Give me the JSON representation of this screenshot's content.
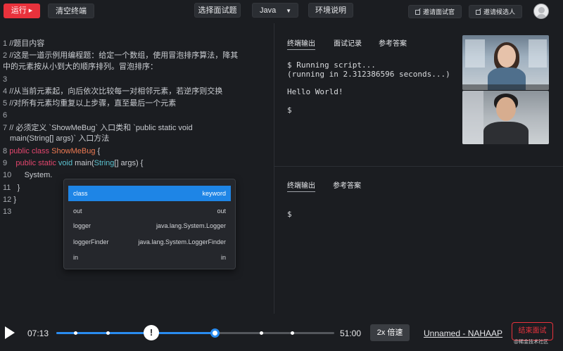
{
  "toolbar": {
    "run_label": "运行",
    "clear_label": "清空终端",
    "choose_question_label": "选择面试题",
    "language_value": "Java",
    "env_label": "环境说明",
    "invite_interviewer_label": "邀请面试官",
    "invite_candidate_label": "邀请候选人"
  },
  "editor": {
    "lines": [
      {
        "num": "1",
        "text": "//题目内容"
      },
      {
        "num": "2",
        "text": "//这是一道示例用编程题：给定一个数组，使用冒泡排序算法，降其"
      },
      {
        "num": "",
        "text": "中的元素按从小到大的顺序排列。冒泡排序："
      },
      {
        "num": "3",
        "text": ""
      },
      {
        "num": "4",
        "text": "//从当前元素起，向后依次比较每一对相邻元素，若逆序则交换"
      },
      {
        "num": "5",
        "text": "//对所有元素均重复以上步骤，直至最后一个元素"
      },
      {
        "num": "6",
        "text": ""
      },
      {
        "num": "7",
        "text": "// 必须定义 `ShowMeBug` 入口类和 `public static void"
      },
      {
        "num": "",
        "text": "main(String[] args)` 入口方法"
      },
      {
        "num": "8",
        "kw1": "public class ",
        "cls": "ShowMeBug",
        "rest": " {"
      },
      {
        "num": "9",
        "kw1": "public static ",
        "typ1": "void",
        "mid": " main(",
        "typ2": "String",
        "rest": "[] args) {"
      },
      {
        "num": "10",
        "text": "System."
      },
      {
        "num": "11",
        "text": "}"
      },
      {
        "num": "12",
        "text": "}"
      },
      {
        "num": "13",
        "text": ""
      }
    ],
    "autocomplete": [
      {
        "label": "class",
        "detail": "keyword"
      },
      {
        "label": "out",
        "detail": "out"
      },
      {
        "label": "logger",
        "detail": "java.lang.System.Logger"
      },
      {
        "label": "loggerFinder",
        "detail": "java.lang.System.LoggerFinder"
      },
      {
        "label": "in",
        "detail": "in"
      }
    ]
  },
  "terminal_top": {
    "tabs": [
      "终端输出",
      "面试记录",
      "参考答案"
    ],
    "lines": [
      "$ Running script...",
      "(running in 2.312386596 seconds...)",
      "",
      "Hello World!",
      "",
      "$"
    ]
  },
  "terminal_bottom": {
    "tabs": [
      "终端输出",
      "参考答案"
    ],
    "prompt": "$"
  },
  "player": {
    "current_time": "07:13",
    "total_time": "51:00",
    "progress": 0.57,
    "marker_symbol": "!",
    "speed_label": "2x 倍速",
    "session_link": "Unnamed - NAHAAP",
    "end_label": "结束面试",
    "watermark": "@稀金技术社区"
  },
  "colors": {
    "accent_red": "#e8323c",
    "accent_blue": "#2a8cf0",
    "keyword": "#e2466d",
    "class_name": "#ee7a52",
    "type": "#5cc3d0"
  }
}
